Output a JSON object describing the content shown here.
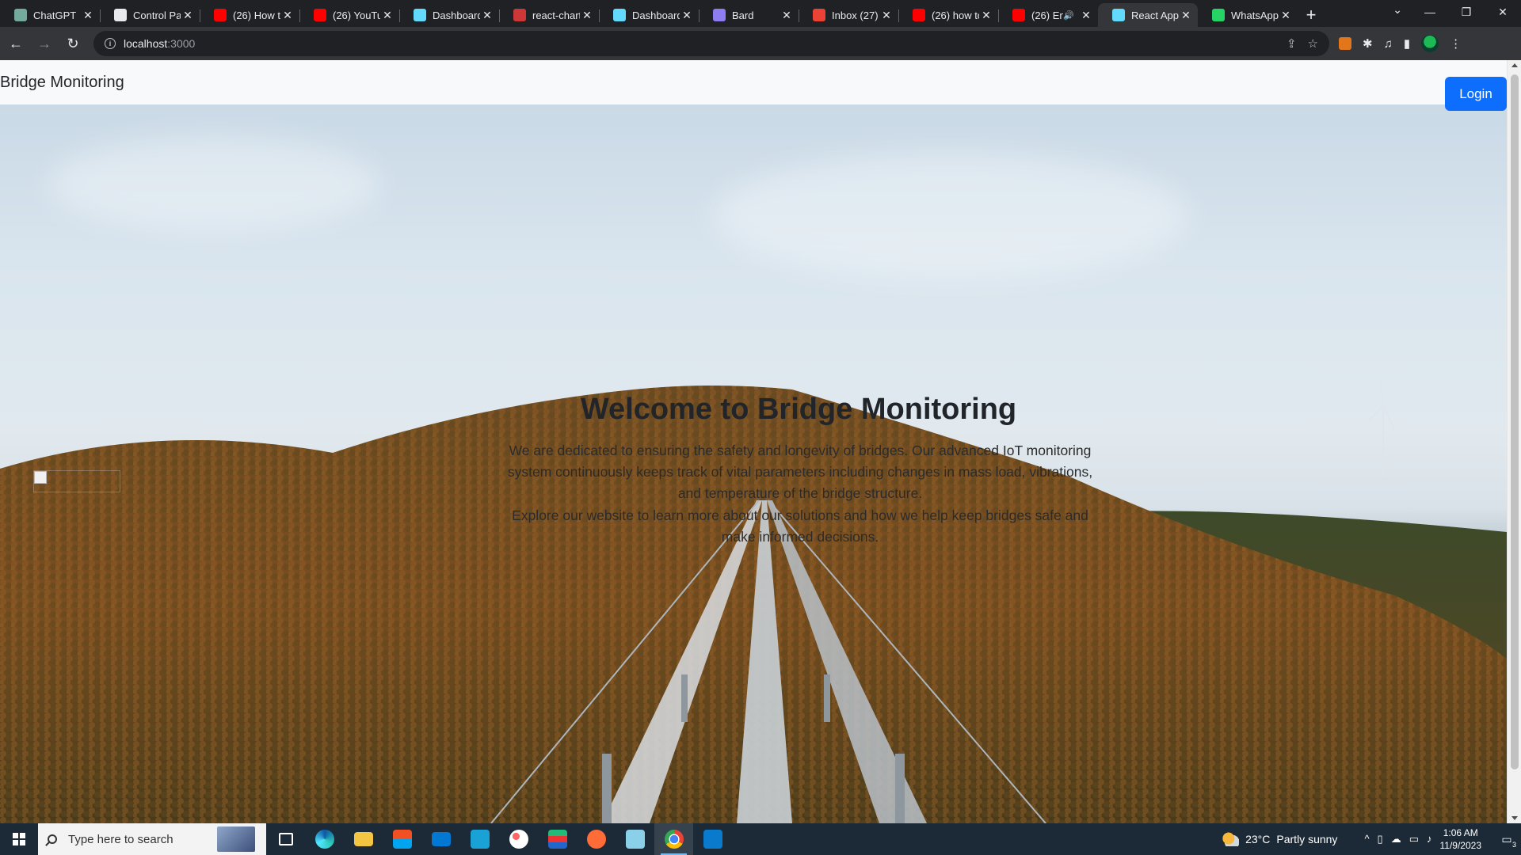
{
  "browser": {
    "tabs": [
      {
        "title": "ChatGPT",
        "icon": "chatgpt-icon",
        "color": "#74aa9c"
      },
      {
        "title": "Control Par",
        "icon": "control-panel-icon",
        "color": "#e8eaed"
      },
      {
        "title": "(26) How t",
        "icon": "youtube-icon",
        "color": "#ff0000"
      },
      {
        "title": "(26) YouTu",
        "icon": "youtube-icon",
        "color": "#ff0000"
      },
      {
        "title": "Dashboard",
        "icon": "react-icon",
        "color": "#61dafb"
      },
      {
        "title": "react-chart",
        "icon": "npm-icon",
        "color": "#cb3837"
      },
      {
        "title": "Dashboard",
        "icon": "react-icon",
        "color": "#61dafb"
      },
      {
        "title": "Bard",
        "icon": "bard-icon",
        "color": "#8e7cf0"
      },
      {
        "title": "Inbox (27)",
        "icon": "gmail-icon",
        "color": "#ea4335"
      },
      {
        "title": "(26) how to",
        "icon": "youtube-icon",
        "color": "#ff0000"
      },
      {
        "title": "(26) En",
        "icon": "youtube-icon",
        "color": "#ff0000"
      },
      {
        "title": "React App",
        "icon": "react-icon",
        "color": "#61dafb"
      },
      {
        "title": "WhatsApp",
        "icon": "whatsapp-icon",
        "color": "#25d366"
      }
    ],
    "active_tab": "React App",
    "url_host": "localhost",
    "url_port": ":3000"
  },
  "page": {
    "brand": "Bridge Monitoring",
    "login_label": "Login",
    "hero_title": "Welcome to Bridge Monitoring",
    "hero_text_1": "We are dedicated to ensuring the safety and longevity of bridges. Our advanced IoT monitoring system continuously keeps track of vital parameters including changes in mass load, vibrations, and temperature of the bridge structure.",
    "hero_text_2": "Explore our website to learn more about our solutions and how we help keep bridges safe and make informed decisions."
  },
  "taskbar": {
    "search_placeholder": "Type here to search",
    "weather_temp": "23°C",
    "weather_desc": "Partly sunny",
    "time": "1:06 AM",
    "date": "11/9/2023",
    "notification_count": "3"
  },
  "colors": {
    "primary_button": "#0d6efd",
    "navbar_bg": "#f8f9fa",
    "browser_dark": "#202124"
  }
}
